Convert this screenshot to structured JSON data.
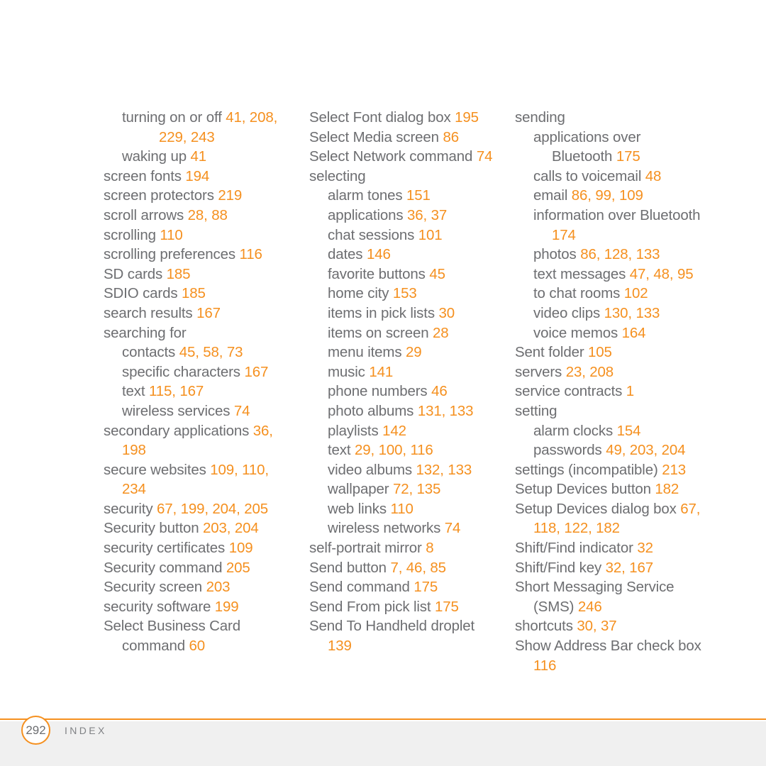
{
  "document": {
    "type": "book-index-page",
    "page_number": "292",
    "footer_label": "INDEX",
    "colors": {
      "page_background": "#ffffff",
      "body_text": "#6d6e71",
      "page_reference_accent": "#f5901f",
      "footer_band": "#f0f0f0",
      "footer_rule": "#f5901f"
    }
  },
  "columns": [
    {
      "name": "column-1",
      "entries": [
        {
          "level": 1,
          "lines": [
            {
              "indent": 1,
              "text": "turning on or off ",
              "pages": "41, 208,"
            },
            {
              "indent": 3,
              "text": "",
              "pages": "229, 243"
            }
          ]
        },
        {
          "level": 1,
          "lines": [
            {
              "indent": 1,
              "text": "waking up ",
              "pages": "41"
            }
          ]
        },
        {
          "level": 0,
          "lines": [
            {
              "indent": 0,
              "text": "screen fonts ",
              "pages": "194"
            }
          ]
        },
        {
          "level": 0,
          "lines": [
            {
              "indent": 0,
              "text": "screen protectors ",
              "pages": "219"
            }
          ]
        },
        {
          "level": 0,
          "lines": [
            {
              "indent": 0,
              "text": "scroll arrows ",
              "pages": "28, 88"
            }
          ]
        },
        {
          "level": 0,
          "lines": [
            {
              "indent": 0,
              "text": "scrolling ",
              "pages": "110"
            }
          ]
        },
        {
          "level": 0,
          "lines": [
            {
              "indent": 0,
              "text": "scrolling preferences ",
              "pages": "116"
            }
          ]
        },
        {
          "level": 0,
          "lines": [
            {
              "indent": 0,
              "text": "SD cards ",
              "pages": "185"
            }
          ]
        },
        {
          "level": 0,
          "lines": [
            {
              "indent": 0,
              "text": "SDIO cards ",
              "pages": "185"
            }
          ]
        },
        {
          "level": 0,
          "lines": [
            {
              "indent": 0,
              "text": "search results ",
              "pages": "167"
            }
          ]
        },
        {
          "level": 0,
          "lines": [
            {
              "indent": 0,
              "text": "searching for",
              "pages": ""
            }
          ]
        },
        {
          "level": 1,
          "lines": [
            {
              "indent": 1,
              "text": "contacts ",
              "pages": "45, 58, 73"
            }
          ]
        },
        {
          "level": 1,
          "lines": [
            {
              "indent": 1,
              "text": "specific characters ",
              "pages": "167"
            }
          ]
        },
        {
          "level": 1,
          "lines": [
            {
              "indent": 1,
              "text": "text ",
              "pages": "115, 167"
            }
          ]
        },
        {
          "level": 1,
          "lines": [
            {
              "indent": 1,
              "text": "wireless services ",
              "pages": "74"
            }
          ]
        },
        {
          "level": 0,
          "lines": [
            {
              "indent": 0,
              "text": "secondary applications ",
              "pages": "36,"
            },
            {
              "indent": 1,
              "text": "",
              "pages": "198"
            }
          ]
        },
        {
          "level": 0,
          "lines": [
            {
              "indent": 0,
              "text": "secure websites ",
              "pages": "109, 110,"
            },
            {
              "indent": 1,
              "text": "",
              "pages": "234"
            }
          ]
        },
        {
          "level": 0,
          "lines": [
            {
              "indent": 0,
              "text": "security ",
              "pages": "67, 199, 204, 205"
            }
          ]
        },
        {
          "level": 0,
          "lines": [
            {
              "indent": 0,
              "text": "Security button ",
              "pages": "203, 204"
            }
          ]
        },
        {
          "level": 0,
          "lines": [
            {
              "indent": 0,
              "text": "security certificates ",
              "pages": "109"
            }
          ]
        },
        {
          "level": 0,
          "lines": [
            {
              "indent": 0,
              "text": "Security command ",
              "pages": "205"
            }
          ]
        },
        {
          "level": 0,
          "lines": [
            {
              "indent": 0,
              "text": "Security screen ",
              "pages": "203"
            }
          ]
        },
        {
          "level": 0,
          "lines": [
            {
              "indent": 0,
              "text": "security software ",
              "pages": "199"
            }
          ]
        },
        {
          "level": 0,
          "lines": [
            {
              "indent": 0,
              "text": "Select Business Card",
              "pages": ""
            },
            {
              "indent": 1,
              "text": "command ",
              "pages": "60"
            }
          ]
        }
      ]
    },
    {
      "name": "column-2",
      "entries": [
        {
          "level": 0,
          "lines": [
            {
              "indent": 0,
              "text": "Select Font dialog box ",
              "pages": "195"
            }
          ]
        },
        {
          "level": 0,
          "lines": [
            {
              "indent": 0,
              "text": "Select Media screen ",
              "pages": "86"
            }
          ]
        },
        {
          "level": 0,
          "lines": [
            {
              "indent": 0,
              "text": "Select Network command ",
              "pages": "74"
            }
          ]
        },
        {
          "level": 0,
          "lines": [
            {
              "indent": 0,
              "text": "selecting",
              "pages": ""
            }
          ]
        },
        {
          "level": 1,
          "lines": [
            {
              "indent": 1,
              "text": "alarm tones ",
              "pages": "151"
            }
          ]
        },
        {
          "level": 1,
          "lines": [
            {
              "indent": 1,
              "text": "applications ",
              "pages": "36, 37"
            }
          ]
        },
        {
          "level": 1,
          "lines": [
            {
              "indent": 1,
              "text": "chat sessions ",
              "pages": "101"
            }
          ]
        },
        {
          "level": 1,
          "lines": [
            {
              "indent": 1,
              "text": "dates ",
              "pages": "146"
            }
          ]
        },
        {
          "level": 1,
          "lines": [
            {
              "indent": 1,
              "text": "favorite buttons ",
              "pages": "45"
            }
          ]
        },
        {
          "level": 1,
          "lines": [
            {
              "indent": 1,
              "text": "home city ",
              "pages": "153"
            }
          ]
        },
        {
          "level": 1,
          "lines": [
            {
              "indent": 1,
              "text": "items in pick lists ",
              "pages": "30"
            }
          ]
        },
        {
          "level": 1,
          "lines": [
            {
              "indent": 1,
              "text": "items on screen ",
              "pages": "28"
            }
          ]
        },
        {
          "level": 1,
          "lines": [
            {
              "indent": 1,
              "text": "menu items ",
              "pages": "29"
            }
          ]
        },
        {
          "level": 1,
          "lines": [
            {
              "indent": 1,
              "text": "music ",
              "pages": "141"
            }
          ]
        },
        {
          "level": 1,
          "lines": [
            {
              "indent": 1,
              "text": "phone numbers ",
              "pages": "46"
            }
          ]
        },
        {
          "level": 1,
          "lines": [
            {
              "indent": 1,
              "text": "photo albums ",
              "pages": "131, 133"
            }
          ]
        },
        {
          "level": 1,
          "lines": [
            {
              "indent": 1,
              "text": "playlists ",
              "pages": "142"
            }
          ]
        },
        {
          "level": 1,
          "lines": [
            {
              "indent": 1,
              "text": "text ",
              "pages": "29, 100, 116"
            }
          ]
        },
        {
          "level": 1,
          "lines": [
            {
              "indent": 1,
              "text": "video albums ",
              "pages": "132, 133"
            }
          ]
        },
        {
          "level": 1,
          "lines": [
            {
              "indent": 1,
              "text": "wallpaper ",
              "pages": "72, 135"
            }
          ]
        },
        {
          "level": 1,
          "lines": [
            {
              "indent": 1,
              "text": "web links ",
              "pages": "110"
            }
          ]
        },
        {
          "level": 1,
          "lines": [
            {
              "indent": 1,
              "text": "wireless networks ",
              "pages": "74"
            }
          ]
        },
        {
          "level": 0,
          "lines": [
            {
              "indent": 0,
              "text": "self-portrait mirror ",
              "pages": "8"
            }
          ]
        },
        {
          "level": 0,
          "lines": [
            {
              "indent": 0,
              "text": "Send button ",
              "pages": "7, 46, 85"
            }
          ]
        },
        {
          "level": 0,
          "lines": [
            {
              "indent": 0,
              "text": "Send command ",
              "pages": "175"
            }
          ]
        },
        {
          "level": 0,
          "lines": [
            {
              "indent": 0,
              "text": "Send From pick list ",
              "pages": "175"
            }
          ]
        },
        {
          "level": 0,
          "lines": [
            {
              "indent": 0,
              "text": "Send To Handheld droplet",
              "pages": ""
            },
            {
              "indent": 1,
              "text": "",
              "pages": "139"
            }
          ]
        }
      ]
    },
    {
      "name": "column-3",
      "entries": [
        {
          "level": 0,
          "lines": [
            {
              "indent": 0,
              "text": "sending",
              "pages": ""
            }
          ]
        },
        {
          "level": 1,
          "lines": [
            {
              "indent": 1,
              "text": "applications over",
              "pages": ""
            },
            {
              "indent": 2,
              "text": "Bluetooth ",
              "pages": "175"
            }
          ]
        },
        {
          "level": 1,
          "lines": [
            {
              "indent": 1,
              "text": "calls to voicemail ",
              "pages": "48"
            }
          ]
        },
        {
          "level": 1,
          "lines": [
            {
              "indent": 1,
              "text": "email ",
              "pages": "86, 99, 109"
            }
          ]
        },
        {
          "level": 1,
          "lines": [
            {
              "indent": 1,
              "text": "information over Bluetooth",
              "pages": ""
            },
            {
              "indent": 2,
              "text": "",
              "pages": "174"
            }
          ]
        },
        {
          "level": 1,
          "lines": [
            {
              "indent": 1,
              "text": "photos ",
              "pages": "86, 128, 133"
            }
          ]
        },
        {
          "level": 1,
          "lines": [
            {
              "indent": 1,
              "text": "text messages ",
              "pages": "47, 48, 95"
            }
          ]
        },
        {
          "level": 1,
          "lines": [
            {
              "indent": 1,
              "text": "to chat rooms ",
              "pages": "102"
            }
          ]
        },
        {
          "level": 1,
          "lines": [
            {
              "indent": 1,
              "text": "video clips ",
              "pages": "130, 133"
            }
          ]
        },
        {
          "level": 1,
          "lines": [
            {
              "indent": 1,
              "text": "voice memos ",
              "pages": "164"
            }
          ]
        },
        {
          "level": 0,
          "lines": [
            {
              "indent": 0,
              "text": "Sent folder ",
              "pages": "105"
            }
          ]
        },
        {
          "level": 0,
          "lines": [
            {
              "indent": 0,
              "text": "servers ",
              "pages": "23, 208"
            }
          ]
        },
        {
          "level": 0,
          "lines": [
            {
              "indent": 0,
              "text": "service contracts ",
              "pages": "1"
            }
          ]
        },
        {
          "level": 0,
          "lines": [
            {
              "indent": 0,
              "text": "setting",
              "pages": ""
            }
          ]
        },
        {
          "level": 1,
          "lines": [
            {
              "indent": 1,
              "text": "alarm clocks ",
              "pages": "154"
            }
          ]
        },
        {
          "level": 1,
          "lines": [
            {
              "indent": 1,
              "text": "passwords ",
              "pages": "49, 203, 204"
            }
          ]
        },
        {
          "level": 0,
          "lines": [
            {
              "indent": 0,
              "text": "settings (incompatible) ",
              "pages": "213"
            }
          ]
        },
        {
          "level": 0,
          "lines": [
            {
              "indent": 0,
              "text": "Setup Devices button ",
              "pages": "182"
            }
          ]
        },
        {
          "level": 0,
          "lines": [
            {
              "indent": 0,
              "text": "Setup Devices dialog box ",
              "pages": "67,"
            },
            {
              "indent": 1,
              "text": "",
              "pages": "118, 122, 182"
            }
          ]
        },
        {
          "level": 0,
          "lines": [
            {
              "indent": 0,
              "text": "Shift/Find indicator ",
              "pages": "32"
            }
          ]
        },
        {
          "level": 0,
          "lines": [
            {
              "indent": 0,
              "text": "Shift/Find key ",
              "pages": "32, 167"
            }
          ]
        },
        {
          "level": 0,
          "lines": [
            {
              "indent": 0,
              "text": "Short Messaging Service",
              "pages": ""
            },
            {
              "indent": 1,
              "text": "(SMS) ",
              "pages": "246"
            }
          ]
        },
        {
          "level": 0,
          "lines": [
            {
              "indent": 0,
              "text": "shortcuts ",
              "pages": "30, 37"
            }
          ]
        },
        {
          "level": 0,
          "lines": [
            {
              "indent": 0,
              "text": "Show Address Bar check box",
              "pages": ""
            },
            {
              "indent": 1,
              "text": "",
              "pages": "116"
            }
          ]
        }
      ]
    }
  ]
}
